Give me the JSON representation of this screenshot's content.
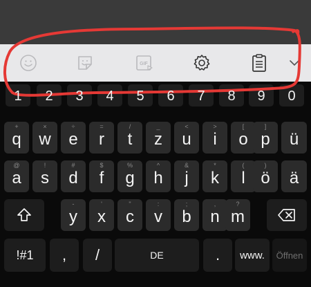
{
  "toolbar": {
    "icons": [
      "emoji-icon",
      "sticker-icon",
      "gif-icon",
      "settings-gear-icon",
      "clipboard-icon",
      "chevron-down-icon"
    ],
    "gif_label": "GIF"
  },
  "number_row": [
    "1",
    "2",
    "3",
    "4",
    "5",
    "6",
    "7",
    "8",
    "9",
    "0"
  ],
  "rows": [
    {
      "keys": [
        {
          "main": "q",
          "hint": "+"
        },
        {
          "main": "w",
          "hint": "×"
        },
        {
          "main": "e",
          "hint": "÷"
        },
        {
          "main": "r",
          "hint": "="
        },
        {
          "main": "t",
          "hint": "/"
        },
        {
          "main": "z",
          "hint": "_"
        },
        {
          "main": "u",
          "hint": "<"
        },
        {
          "main": "i",
          "hint": ">"
        },
        {
          "main": "o",
          "hint": "["
        },
        {
          "main": "p",
          "hint": "]"
        },
        {
          "main": "ü",
          "hint": ""
        }
      ]
    },
    {
      "keys": [
        {
          "main": "a",
          "hint": "@"
        },
        {
          "main": "s",
          "hint": "!"
        },
        {
          "main": "d",
          "hint": "#"
        },
        {
          "main": "f",
          "hint": "$"
        },
        {
          "main": "g",
          "hint": "%"
        },
        {
          "main": "h",
          "hint": "^"
        },
        {
          "main": "j",
          "hint": "&"
        },
        {
          "main": "k",
          "hint": "*"
        },
        {
          "main": "l",
          "hint": "("
        },
        {
          "main": "ö",
          "hint": ")"
        },
        {
          "main": "ä",
          "hint": ""
        }
      ]
    },
    {
      "keys": [
        {
          "main": "y",
          "hint": "-"
        },
        {
          "main": "x",
          "hint": "'"
        },
        {
          "main": "c",
          "hint": "\""
        },
        {
          "main": "v",
          "hint": ":"
        },
        {
          "main": "b",
          "hint": ";"
        },
        {
          "main": "n",
          "hint": ","
        },
        {
          "main": "m",
          "hint": "?"
        }
      ]
    }
  ],
  "bottom": {
    "symbols_label": "!#1",
    "comma_label": ",",
    "slash_label": "/",
    "space_label": "DE",
    "period_label": ".",
    "www_label": "www.",
    "enter_label": "Öffnen"
  },
  "colors": {
    "annotation": "#e53935",
    "toolbar_bg": "#e8e8ea",
    "key_bg": "#2b2b2b"
  }
}
